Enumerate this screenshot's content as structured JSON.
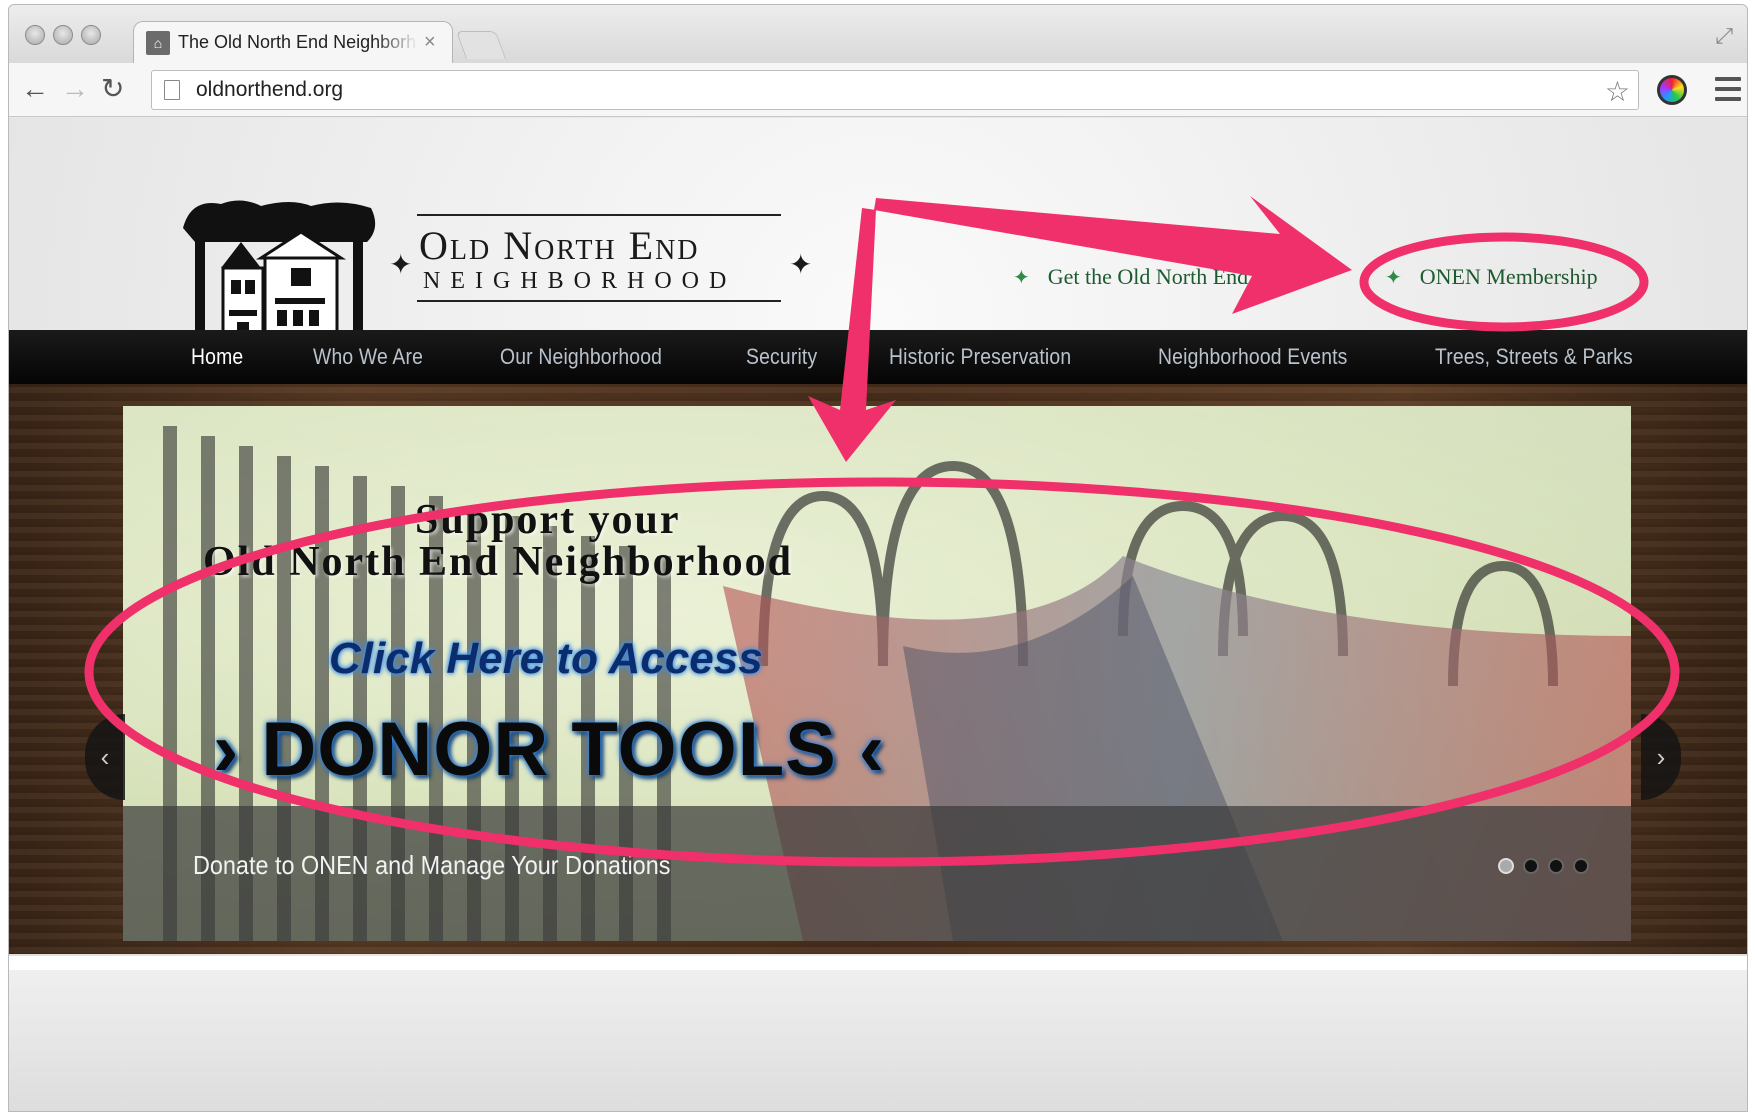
{
  "browser": {
    "tab_title": "The Old North End Neighborhood",
    "tab_close": "×",
    "url": "oldnorthend.org",
    "back": "←",
    "forward": "→",
    "reload": "↻",
    "star": "☆",
    "fullscreen": "⤢"
  },
  "site": {
    "logo_title": "Old North End",
    "logo_subtitle": "NEIGHBORHOOD",
    "logo_diamond": "✦",
    "top_links": [
      {
        "bullet": "✦",
        "label": "Get the Old North End Book"
      },
      {
        "bullet": "✦",
        "label": "ONEN Membership"
      }
    ],
    "nav": [
      "Home",
      "Who We Are",
      "Our Neighborhood",
      "Security",
      "Historic Preservation",
      "Neighborhood Events",
      "Trees, Streets & Parks"
    ]
  },
  "slider": {
    "heading_line1": "Support your",
    "heading_line2": "Old North End Neighborhood",
    "cta_line1": "Click Here to Access",
    "cta_line2": "› DONOR TOOLS ‹",
    "caption": "Donate to ONEN and Manage Your Donations",
    "prev": "‹",
    "next": "›",
    "slide_count": 4,
    "active_slide": 1
  },
  "annotation_color": "#f0306a"
}
